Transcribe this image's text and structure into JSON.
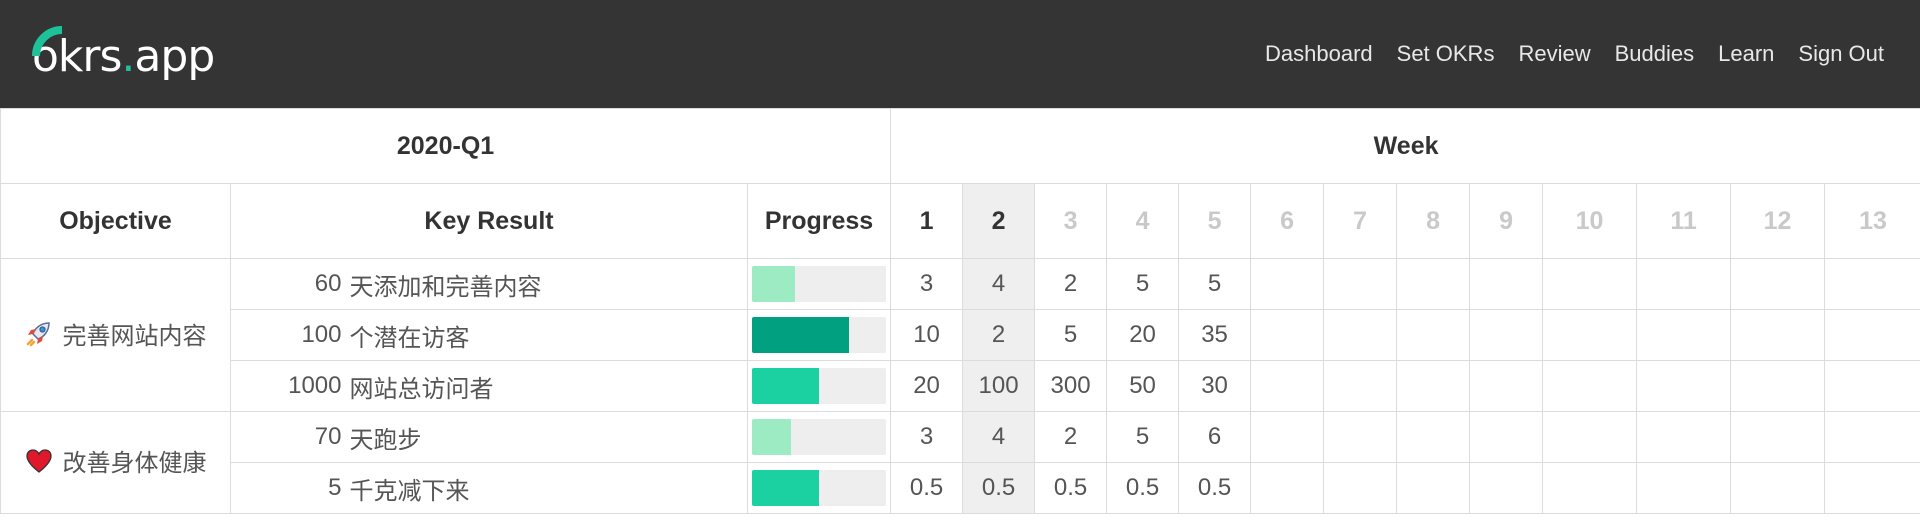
{
  "nav": {
    "logo_main": "okrs",
    "logo_dot": ".",
    "logo_tld": "app",
    "links": [
      "Dashboard",
      "Set OKRs",
      "Review",
      "Buddies",
      "Learn",
      "Sign Out"
    ]
  },
  "table": {
    "quarter": "2020-Q1",
    "week_title": "Week",
    "headers": {
      "objective": "Objective",
      "key_result": "Key Result",
      "progress": "Progress"
    },
    "weeks": [
      "1",
      "2",
      "3",
      "4",
      "5",
      "6",
      "7",
      "8",
      "9",
      "10",
      "11",
      "12",
      "13"
    ],
    "current_week": "2",
    "objectives": [
      {
        "icon": "rocket-icon",
        "title": "完善网站内容",
        "key_results": [
          {
            "target": "60",
            "text": "天添加和完善内容",
            "progress": 0.32,
            "color": "#9cebc3",
            "weekly": [
              "3",
              "4",
              "2",
              "5",
              "5"
            ]
          },
          {
            "target": "100",
            "text": "个潜在访客",
            "progress": 0.72,
            "color": "#00a080",
            "weekly": [
              "10",
              "2",
              "5",
              "20",
              "35"
            ]
          },
          {
            "target": "1000",
            "text": "网站总访问者",
            "progress": 0.5,
            "color": "#1bd1a1",
            "weekly": [
              "20",
              "100",
              "300",
              "50",
              "30"
            ]
          }
        ]
      },
      {
        "icon": "heart-icon",
        "title": "改善身体健康",
        "key_results": [
          {
            "target": "70",
            "text": "天跑步",
            "progress": 0.29,
            "color": "#9cebc3",
            "weekly": [
              "3",
              "4",
              "2",
              "5",
              "6"
            ]
          },
          {
            "target": "5",
            "text": "千克减下来",
            "progress": 0.5,
            "color": "#1bd1a1",
            "weekly": [
              "0.5",
              "0.5",
              "0.5",
              "0.5",
              "0.5"
            ]
          }
        ]
      }
    ]
  }
}
